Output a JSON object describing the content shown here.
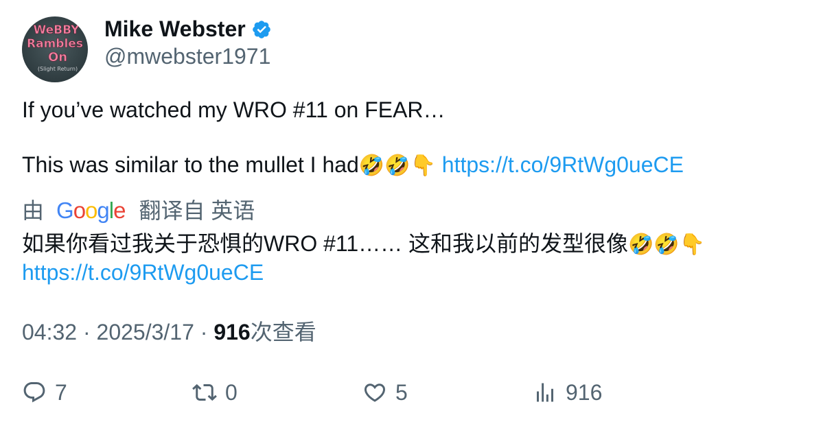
{
  "author": {
    "display_name": "Mike Webster",
    "handle": "@mwebster1971",
    "verified": true,
    "avatar_text": [
      "WeBBY",
      "Rambles",
      "On",
      "(Slight Return)"
    ]
  },
  "tweet": {
    "line1": "If you’ve watched my WRO #11 on FEAR…",
    "line2_text": "This was similar to the mullet I had",
    "line2_emoji": "🤣🤣👇",
    "link": "https://t.co/9RtWg0ueCE"
  },
  "translation": {
    "by": "由",
    "provider": "Google",
    "label": "翻译自 英语",
    "text": "如果你看过我关于恐惧的WRO #11…… 这和我以前的发型很像",
    "emoji": "🤣🤣👇",
    "link": "https://t.co/9RtWg0ueCE"
  },
  "meta": {
    "time": "04:32",
    "separator": " · ",
    "date": "2025/3/17",
    "views_count": "916",
    "views_label": "次查看"
  },
  "actions": {
    "replies": "7",
    "retweets": "0",
    "likes": "5",
    "views": "916"
  },
  "colors": {
    "link": "#1d9bf0",
    "secondary_text": "#536471",
    "primary_text": "#0f1419",
    "verified": "#1d9bf0"
  }
}
